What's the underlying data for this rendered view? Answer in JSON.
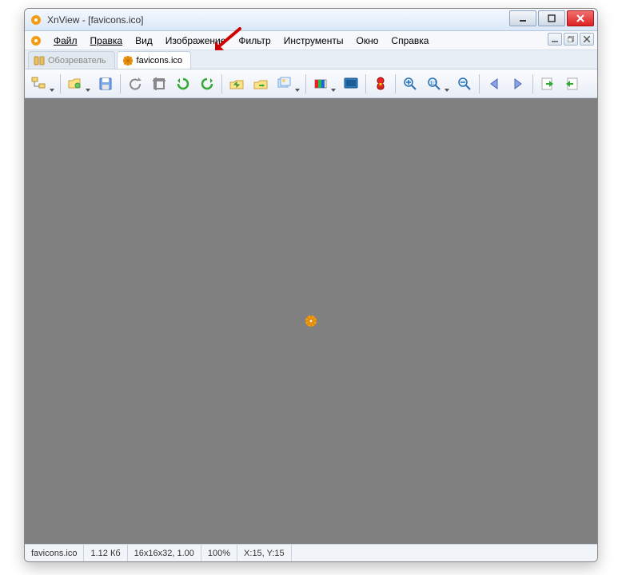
{
  "titlebar": {
    "title": "XnView - [favicons.ico]"
  },
  "menu": {
    "items": [
      "Файл",
      "Правка",
      "Вид",
      "Изображение",
      "Фильтр",
      "Инструменты",
      "Окно",
      "Справка"
    ]
  },
  "tabs": {
    "browser": {
      "label": "Обозреватель"
    },
    "file": {
      "label": "favicons.ico"
    }
  },
  "toolbar": {
    "tree_btn": "tree-view",
    "open_btn": "open",
    "save_btn": "save",
    "undo_btn": "undo",
    "crop_btn": "crop",
    "rotate_ccw_btn": "rotate-ccw",
    "rotate_cw_btn": "rotate-cw",
    "prev_file_btn": "prev-file",
    "next_file_btn": "next-file",
    "slideshow_btn": "slideshow",
    "adjust_btn": "adjust",
    "fullscreen_btn": "fullscreen",
    "red_eye_btn": "red-eye",
    "zoom_in_btn": "zoom-in",
    "zoom_actual_btn": "zoom-actual",
    "zoom_out_btn": "zoom-out",
    "go_back_btn": "go-back",
    "go_fwd_btn": "go-forward",
    "import_btn": "import",
    "export_btn": "export"
  },
  "status": {
    "filename": "favicons.ico",
    "filesize": "1.12 Кб",
    "dimensions": "16x16x32, 1.00",
    "zoom": "100%",
    "coords": "X:15, Y:15"
  }
}
